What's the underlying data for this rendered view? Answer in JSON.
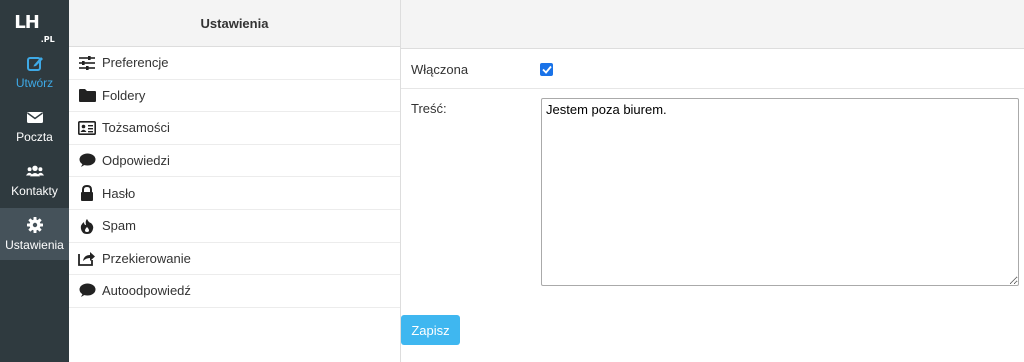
{
  "logo": {
    "text": "LH",
    "suffix": ".PL"
  },
  "rail": {
    "items": [
      {
        "label": "Utwórz",
        "icon": "compose-icon"
      },
      {
        "label": "Poczta",
        "icon": "envelope-icon"
      },
      {
        "label": "Kontakty",
        "icon": "users-icon"
      },
      {
        "label": "Ustawienia",
        "icon": "gear-icon"
      }
    ]
  },
  "sections": {
    "title": "Ustawienia",
    "items": [
      {
        "label": "Preferencje",
        "icon": "sliders-icon"
      },
      {
        "label": "Foldery",
        "icon": "folder-icon"
      },
      {
        "label": "Tożsamości",
        "icon": "id-card-icon"
      },
      {
        "label": "Odpowiedzi",
        "icon": "comment-icon"
      },
      {
        "label": "Hasło",
        "icon": "lock-icon"
      },
      {
        "label": "Spam",
        "icon": "fire-icon"
      },
      {
        "label": "Przekierowanie",
        "icon": "share-icon"
      },
      {
        "label": "Autoodpowiedź",
        "icon": "comment-icon"
      }
    ]
  },
  "form": {
    "enabled_label": "Włączona",
    "enabled_checked": true,
    "body_label": "Treść:",
    "body_value": "Jestem poza biurem.",
    "save_label": "Zapisz"
  },
  "colors": {
    "rail_bg": "#2f3a3f",
    "rail_active_bg": "#45525a",
    "accent": "#3ea9e6",
    "button": "#3fb7f0",
    "checkbox": "#1a73e8"
  }
}
